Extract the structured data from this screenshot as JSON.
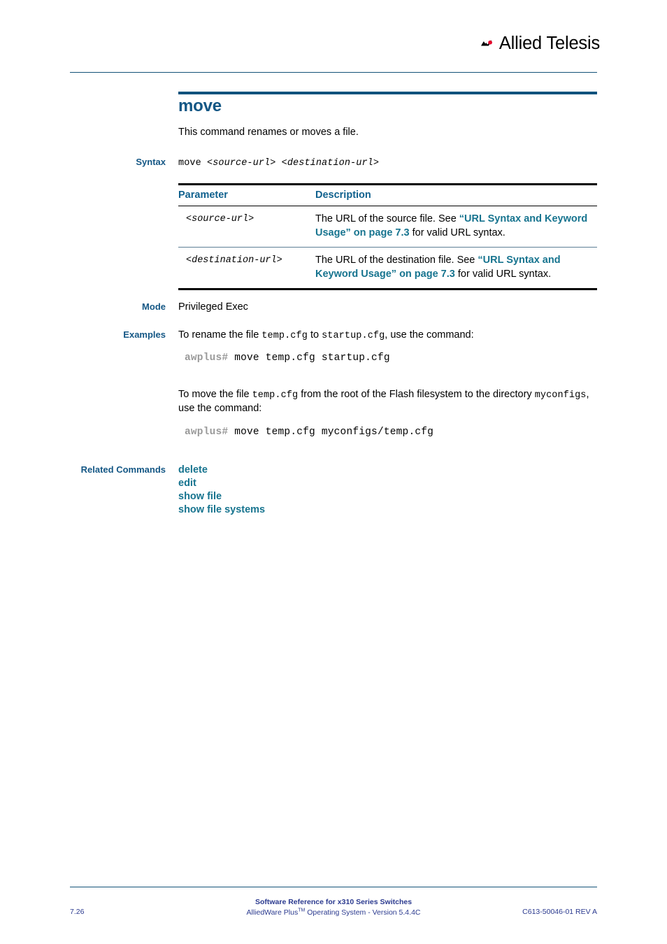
{
  "header": {
    "logo_name": "allied-telesis-logo",
    "brand_text": "Allied Telesis",
    "brand_black": "#000000",
    "brand_red": "#e4002b"
  },
  "colors": {
    "heading_blue": "#145785",
    "label_blue": "#145785",
    "link_teal": "#17748f",
    "rule_blue": "#135278",
    "footer_navy": "#2b3a8f"
  },
  "command": {
    "title": "move",
    "description": "This command renames or moves a file."
  },
  "syntax": {
    "label": "Syntax",
    "command_word": "move ",
    "args": "<source-url> <destination-url>"
  },
  "parameter_table": {
    "headers": [
      "Parameter",
      "Description"
    ],
    "rows": [
      {
        "parameter": "<source-url>",
        "desc_before": "The URL of the source file. See ",
        "desc_link": "“URL Syntax and Keyword Usage” on page 7.3",
        "desc_after": " for valid URL syntax."
      },
      {
        "parameter": "<destination-url>",
        "desc_before": "The URL of the destination file. See ",
        "desc_link": "“URL Syntax and Keyword Usage” on page 7.3",
        "desc_after": " for valid URL syntax."
      }
    ]
  },
  "mode": {
    "label": "Mode",
    "value": "Privileged Exec"
  },
  "examples": {
    "label": "Examples",
    "first": {
      "text_1": "To rename the file ",
      "code_1": "temp.cfg",
      "text_2": " to ",
      "code_2": "startup.cfg",
      "text_3": ", use the command:",
      "prompt": "awplus# ",
      "command": "move temp.cfg startup.cfg"
    },
    "second": {
      "text_1": "To move the file ",
      "code_1": "temp.cfg",
      "text_2": " from the root of the Flash filesystem to the directory ",
      "code_2": "myconfigs",
      "text_3": ", use the command:",
      "prompt": "awplus# ",
      "command": "move temp.cfg myconfigs/temp.cfg"
    }
  },
  "related_commands": {
    "label": "Related Commands",
    "items": [
      "delete",
      "edit",
      "show file",
      "show file systems"
    ]
  },
  "footer": {
    "line_1": "Software Reference for x310 Series Switches",
    "line_2_a": "AlliedWare Plus",
    "line_2_tm": "TM",
    "line_2_b": " Operating System  - Version 5.4.4C",
    "page_number": "7.26",
    "doc_id": "C613-50046-01 REV A"
  }
}
